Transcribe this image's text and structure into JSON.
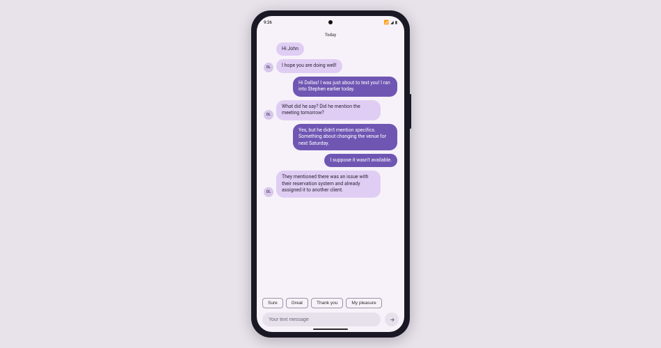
{
  "status_bar": {
    "time": "9:26",
    "wifi_icon": "▾",
    "signal_icon": "▴",
    "battery_icon": "▮"
  },
  "conversation": {
    "date_header": "Today",
    "contact_initials": "DL",
    "messages": [
      {
        "dir": "in",
        "avatar": false,
        "text": "Hi John"
      },
      {
        "dir": "in",
        "avatar": true,
        "text": "I hope you are doing well!"
      },
      {
        "dir": "out",
        "avatar": false,
        "text": "Hi Dallas! I was just about to text you! I ran into Stephen earlier today."
      },
      {
        "dir": "in",
        "avatar": true,
        "text": "What did he say? Did he mention the meeting tomorrow?"
      },
      {
        "dir": "out",
        "avatar": false,
        "text": "Yes, but he didn't mention specifics. Something about changing the venue for next Saturday."
      },
      {
        "dir": "out",
        "avatar": false,
        "text": "I suppose it wasn't available."
      },
      {
        "dir": "in",
        "avatar": true,
        "text": "They mentioned there was an issue with their reservation system and already assigned it to another client."
      }
    ]
  },
  "suggestions": [
    "Sure",
    "Great",
    "Thank you",
    "My pleasure"
  ],
  "composer": {
    "placeholder": "Your text message"
  }
}
